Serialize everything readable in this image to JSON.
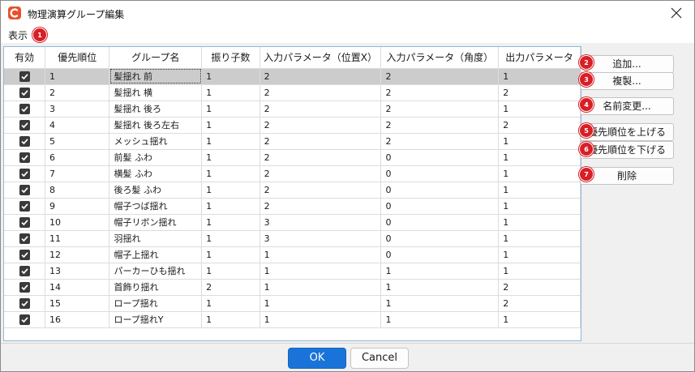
{
  "window": {
    "title": "物理演算グループ編集"
  },
  "menu": {
    "view_label": "表示"
  },
  "badges": [
    "1",
    "2",
    "3",
    "4",
    "5",
    "6",
    "7"
  ],
  "table": {
    "headers": [
      "有効",
      "優先順位",
      "グループ名",
      "振り子数",
      "入力パラメータ（位置X）",
      "入力パラメータ（角度）",
      "出力パラメータ"
    ],
    "rows": [
      {
        "enabled": true,
        "priority": "1",
        "name": "髪揺れ 前",
        "pendulums": "1",
        "in_pos_x": "2",
        "in_angle": "2",
        "output": "1"
      },
      {
        "enabled": true,
        "priority": "2",
        "name": "髪揺れ 横",
        "pendulums": "1",
        "in_pos_x": "2",
        "in_angle": "2",
        "output": "2"
      },
      {
        "enabled": true,
        "priority": "3",
        "name": "髪揺れ 後ろ",
        "pendulums": "1",
        "in_pos_x": "2",
        "in_angle": "2",
        "output": "1"
      },
      {
        "enabled": true,
        "priority": "4",
        "name": "髪揺れ 後ろ左右",
        "pendulums": "1",
        "in_pos_x": "2",
        "in_angle": "2",
        "output": "2"
      },
      {
        "enabled": true,
        "priority": "5",
        "name": "メッシュ揺れ",
        "pendulums": "1",
        "in_pos_x": "2",
        "in_angle": "2",
        "output": "1"
      },
      {
        "enabled": true,
        "priority": "6",
        "name": "前髪 ふわ",
        "pendulums": "1",
        "in_pos_x": "2",
        "in_angle": "0",
        "output": "1"
      },
      {
        "enabled": true,
        "priority": "7",
        "name": "横髪 ふわ",
        "pendulums": "1",
        "in_pos_x": "2",
        "in_angle": "0",
        "output": "1"
      },
      {
        "enabled": true,
        "priority": "8",
        "name": "後ろ髪 ふわ",
        "pendulums": "1",
        "in_pos_x": "2",
        "in_angle": "0",
        "output": "1"
      },
      {
        "enabled": true,
        "priority": "9",
        "name": "帽子つば揺れ",
        "pendulums": "1",
        "in_pos_x": "2",
        "in_angle": "0",
        "output": "1"
      },
      {
        "enabled": true,
        "priority": "10",
        "name": "帽子リボン揺れ",
        "pendulums": "1",
        "in_pos_x": "3",
        "in_angle": "0",
        "output": "1"
      },
      {
        "enabled": true,
        "priority": "11",
        "name": "羽揺れ",
        "pendulums": "1",
        "in_pos_x": "3",
        "in_angle": "0",
        "output": "1"
      },
      {
        "enabled": true,
        "priority": "12",
        "name": "帽子上揺れ",
        "pendulums": "1",
        "in_pos_x": "1",
        "in_angle": "0",
        "output": "1"
      },
      {
        "enabled": true,
        "priority": "13",
        "name": "パーカーひも揺れ",
        "pendulums": "1",
        "in_pos_x": "1",
        "in_angle": "1",
        "output": "1"
      },
      {
        "enabled": true,
        "priority": "14",
        "name": "首飾り揺れ",
        "pendulums": "2",
        "in_pos_x": "1",
        "in_angle": "1",
        "output": "2"
      },
      {
        "enabled": true,
        "priority": "15",
        "name": "ロープ揺れ",
        "pendulums": "1",
        "in_pos_x": "1",
        "in_angle": "1",
        "output": "2"
      },
      {
        "enabled": true,
        "priority": "16",
        "name": "ロープ揺れY",
        "pendulums": "1",
        "in_pos_x": "1",
        "in_angle": "1",
        "output": "1"
      }
    ]
  },
  "buttons": {
    "add": "追加...",
    "duplicate": "複製...",
    "rename": "名前変更...",
    "raise_priority": "優先順位を上げる",
    "lower_priority": "優先順位を下げる",
    "delete": "削除"
  },
  "footer": {
    "ok": "OK",
    "cancel": "Cancel"
  },
  "colors": {
    "badge": "#d81f26",
    "ok_button": "#1a73d9",
    "selected_row": "#cccccc",
    "app_icon": "#e8512a"
  }
}
